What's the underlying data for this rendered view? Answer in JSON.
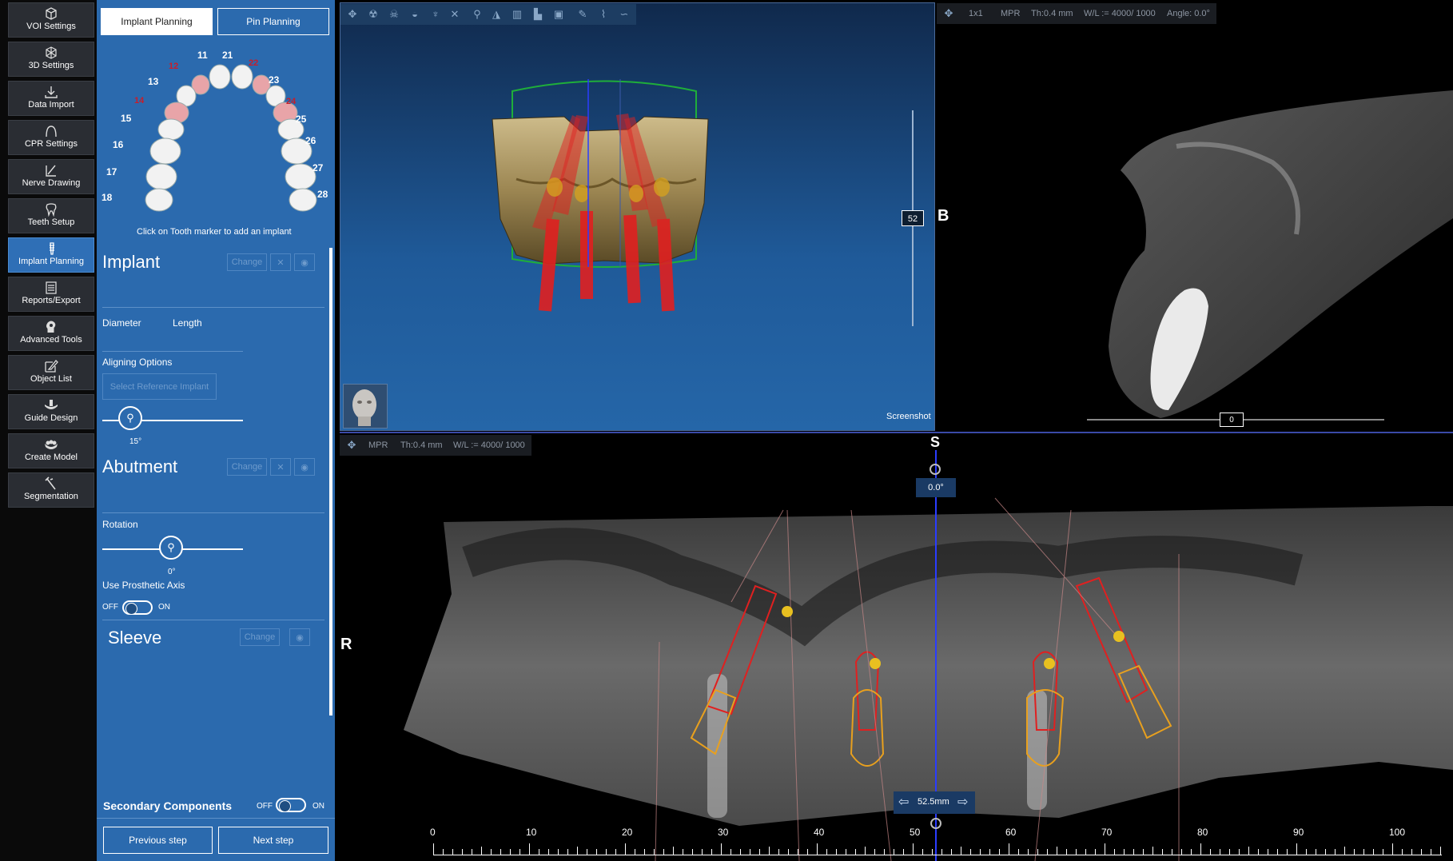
{
  "nav": {
    "items": [
      {
        "label": "VOI Settings",
        "icon": "cube-icon"
      },
      {
        "label": "3D Settings",
        "icon": "3d-cube-icon"
      },
      {
        "label": "Data Import",
        "icon": "download-icon"
      },
      {
        "label": "CPR Settings",
        "icon": "arch-curve-icon"
      },
      {
        "label": "Nerve Drawing",
        "icon": "nerve-pen-icon"
      },
      {
        "label": "Teeth Setup",
        "icon": "tooth-icon"
      },
      {
        "label": "Implant Planning",
        "icon": "implant-icon"
      },
      {
        "label": "Reports/Export",
        "icon": "report-icon"
      },
      {
        "label": "Advanced Tools",
        "icon": "head-gear-icon"
      },
      {
        "label": "Object List",
        "icon": "edit-list-icon"
      },
      {
        "label": "Guide Design",
        "icon": "guide-icon"
      },
      {
        "label": "Create Model",
        "icon": "model-icon"
      },
      {
        "label": "Segmentation",
        "icon": "wand-icon"
      }
    ],
    "active_index": 6
  },
  "panel": {
    "tabs": {
      "implant_planning": "Implant Planning",
      "pin_planning": "Pin Planning"
    },
    "teeth": [
      "11",
      "21",
      "12",
      "22",
      "13",
      "23",
      "14",
      "24",
      "15",
      "25",
      "16",
      "26",
      "17",
      "27",
      "18",
      "28"
    ],
    "hint": "Click on Tooth marker to add an implant",
    "implant": {
      "title": "Implant",
      "change": "Change",
      "diameter": "Diameter",
      "length": "Length",
      "aligning_options": "Aligning Options",
      "select_reference": "Select Reference Implant",
      "angle_value": "15°"
    },
    "abutment": {
      "title": "Abutment",
      "change": "Change",
      "rotation": "Rotation",
      "rotation_value": "0°",
      "use_prosthetic_axis": "Use Prosthetic Axis",
      "off": "OFF",
      "on": "ON"
    },
    "sleeve": {
      "title": "Sleeve",
      "change": "Change"
    },
    "secondary": {
      "label": "Secondary Components",
      "off": "OFF",
      "on": "ON"
    },
    "buttons": {
      "previous": "Previous step",
      "next": "Next step"
    }
  },
  "view3d": {
    "slider_value": "52",
    "screenshot": "Screenshot"
  },
  "sagittal": {
    "status": [
      "1x1",
      "MPR",
      "Th:0.4 mm",
      "W/L := 4000/ 1000",
      "Angle: 0.0°"
    ],
    "side_label": "B",
    "slider_value": "0"
  },
  "panoramic": {
    "status": [
      "MPR",
      "Th:0.4 mm",
      "W/L := 4000/ 1000"
    ],
    "top_label": "S",
    "angle": "0.0°",
    "left_label": "R",
    "position": "52.5mm",
    "ruler": [
      "0",
      "10",
      "20",
      "30",
      "40",
      "50",
      "60",
      "70",
      "80",
      "90",
      "100"
    ]
  },
  "colors": {
    "panel_blue": "#2b6aae",
    "implant_red": "#d41c1c",
    "abutment_orange": "#e8a01e",
    "cursor_blue": "#2a3cff"
  }
}
